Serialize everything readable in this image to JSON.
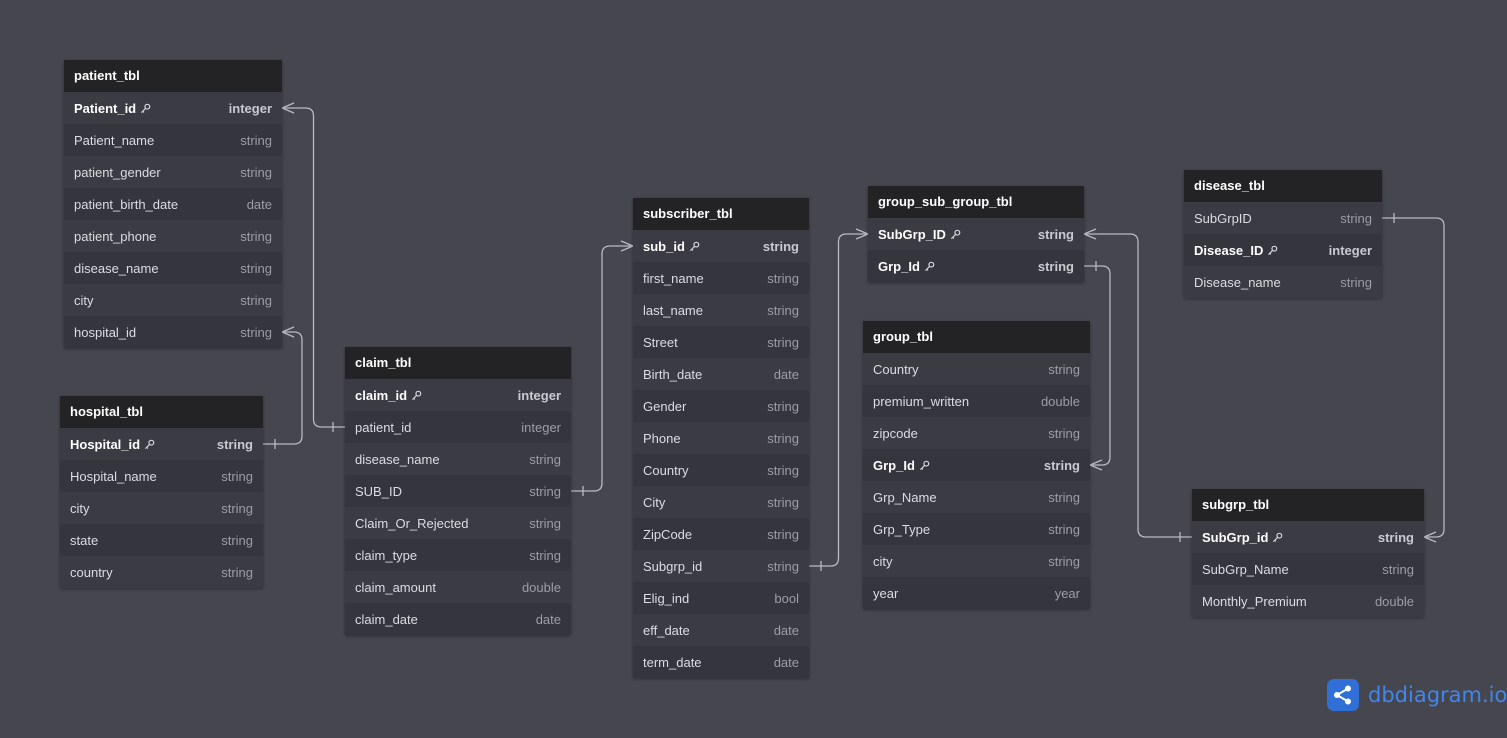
{
  "tables": [
    {
      "id": "patient_tbl",
      "name": "patient_tbl",
      "fields": [
        {
          "name": "Patient_id",
          "type": "integer",
          "pk": true
        },
        {
          "name": "Patient_name",
          "type": "string"
        },
        {
          "name": "patient_gender",
          "type": "string"
        },
        {
          "name": "patient_birth_date",
          "type": "date"
        },
        {
          "name": "patient_phone",
          "type": "string"
        },
        {
          "name": "disease_name",
          "type": "string"
        },
        {
          "name": "city",
          "type": "string"
        },
        {
          "name": "hospital_id",
          "type": "string"
        }
      ]
    },
    {
      "id": "hospital_tbl",
      "name": "hospital_tbl",
      "fields": [
        {
          "name": "Hospital_id",
          "type": "string",
          "pk": true
        },
        {
          "name": "Hospital_name",
          "type": "string"
        },
        {
          "name": "city",
          "type": "string"
        },
        {
          "name": "state",
          "type": "string"
        },
        {
          "name": "country",
          "type": "string"
        }
      ]
    },
    {
      "id": "claim_tbl",
      "name": "claim_tbl",
      "fields": [
        {
          "name": "claim_id",
          "type": "integer",
          "pk": true
        },
        {
          "name": "patient_id",
          "type": "integer"
        },
        {
          "name": "disease_name",
          "type": "string"
        },
        {
          "name": "SUB_ID",
          "type": "string"
        },
        {
          "name": "Claim_Or_Rejected",
          "type": "string"
        },
        {
          "name": "claim_type",
          "type": "string"
        },
        {
          "name": "claim_amount",
          "type": "double"
        },
        {
          "name": "claim_date",
          "type": "date"
        }
      ]
    },
    {
      "id": "subscriber_tbl",
      "name": "subscriber_tbl",
      "fields": [
        {
          "name": "sub_id",
          "type": "string",
          "pk": true
        },
        {
          "name": "first_name",
          "type": "string"
        },
        {
          "name": "last_name",
          "type": "string"
        },
        {
          "name": "Street",
          "type": "string"
        },
        {
          "name": "Birth_date",
          "type": "date"
        },
        {
          "name": "Gender",
          "type": "string"
        },
        {
          "name": "Phone",
          "type": "string"
        },
        {
          "name": "Country",
          "type": "string"
        },
        {
          "name": "City",
          "type": "string"
        },
        {
          "name": "ZipCode",
          "type": "string"
        },
        {
          "name": "Subgrp_id",
          "type": "string"
        },
        {
          "name": "Elig_ind",
          "type": "bool"
        },
        {
          "name": "eff_date",
          "type": "date"
        },
        {
          "name": "term_date",
          "type": "date"
        }
      ]
    },
    {
      "id": "group_sub_group_tbl",
      "name": "group_sub_group_tbl",
      "fields": [
        {
          "name": "SubGrp_ID",
          "type": "string",
          "pk": true
        },
        {
          "name": "Grp_Id",
          "type": "string",
          "pk": true
        }
      ]
    },
    {
      "id": "group_tbl",
      "name": "group_tbl",
      "fields": [
        {
          "name": "Country",
          "type": "string"
        },
        {
          "name": "premium_written",
          "type": "double"
        },
        {
          "name": "zipcode",
          "type": "string"
        },
        {
          "name": "Grp_Id",
          "type": "string",
          "pk": true
        },
        {
          "name": "Grp_Name",
          "type": "string"
        },
        {
          "name": "Grp_Type",
          "type": "string"
        },
        {
          "name": "city",
          "type": "string"
        },
        {
          "name": "year",
          "type": "year"
        }
      ]
    },
    {
      "id": "disease_tbl",
      "name": "disease_tbl",
      "fields": [
        {
          "name": "SubGrpID",
          "type": "string"
        },
        {
          "name": "Disease_ID",
          "type": "integer",
          "pk": true
        },
        {
          "name": "Disease_name",
          "type": "string"
        }
      ]
    },
    {
      "id": "subgrp_tbl",
      "name": "subgrp_tbl",
      "fields": [
        {
          "name": "SubGrp_id",
          "type": "string",
          "pk": true
        },
        {
          "name": "SubGrp_Name",
          "type": "string"
        },
        {
          "name": "Monthly_Premium",
          "type": "double"
        }
      ]
    }
  ],
  "relationships": [
    {
      "from": "patient_tbl.Patient_id",
      "to": "claim_tbl.patient_id",
      "from_end": "many",
      "to_end": "one"
    },
    {
      "from": "patient_tbl.hospital_id",
      "to": "hospital_tbl.Hospital_id",
      "from_end": "many",
      "to_end": "one"
    },
    {
      "from": "claim_tbl.SUB_ID",
      "to": "subscriber_tbl.sub_id",
      "from_end": "one",
      "to_end": "many"
    },
    {
      "from": "subscriber_tbl.Subgrp_id",
      "to": "group_sub_group_tbl.SubGrp_ID",
      "from_end": "one",
      "to_end": "many"
    },
    {
      "from": "group_sub_group_tbl.SubGrp_ID",
      "to": "subgrp_tbl.SubGrp_id",
      "from_end": "many",
      "to_end": "one"
    },
    {
      "from": "group_sub_group_tbl.Grp_Id",
      "to": "group_tbl.Grp_Id",
      "from_end": "one",
      "to_end": "many"
    },
    {
      "from": "disease_tbl.SubGrpID",
      "to": "subgrp_tbl.SubGrp_id",
      "from_end": "one",
      "to_end": "many"
    }
  ],
  "colors": {
    "background": "#46464f",
    "header": "#232325",
    "row_odd": "#3b3b43",
    "row_even": "#35353d",
    "line": "#b9b9c2",
    "brand": "#3f86ee"
  },
  "icons": {
    "primary_key": "key-icon",
    "logo": "share-nodes-icon"
  },
  "logo": {
    "text": "dbdiagram",
    "suffix": ".io"
  }
}
